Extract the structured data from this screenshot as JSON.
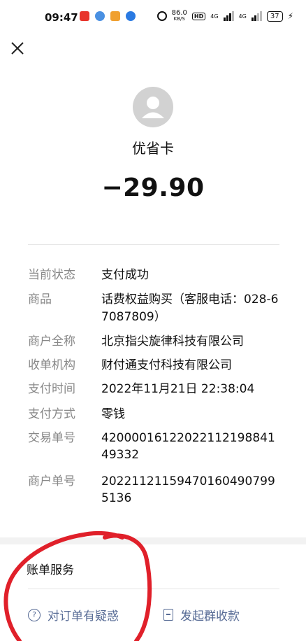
{
  "status_bar": {
    "time": "09:47",
    "net_speed_value": "86.0",
    "net_speed_unit": "KB/S",
    "hd_badge": "HD",
    "signal_1": "4G",
    "signal_2": "4G",
    "battery": "37"
  },
  "merchant": {
    "name": "优省卡",
    "avatar_icon": "user-avatar-icon"
  },
  "amount": "−29.90",
  "details": [
    {
      "label": "当前状态",
      "value": "支付成功"
    },
    {
      "label": "商品",
      "value": "话费权益购买（客服电话：028-67087809）"
    },
    {
      "label": "商户全称",
      "value": "北京指尖旋律科技有限公司"
    },
    {
      "label": "收单机构",
      "value": "财付通支付科技有限公司"
    },
    {
      "label": "支付时间",
      "value": "2022年11月21日 22:38:04"
    },
    {
      "label": "支付方式",
      "value": "零钱"
    },
    {
      "label": "交易单号",
      "value": "4200001612202211219884149332"
    },
    {
      "label": "商户单号",
      "value": "202211211594701604907995136"
    }
  ],
  "bill_service": {
    "title": "账单服务",
    "question_label": "对订单有疑惑",
    "group_collect_label": "发起群收款"
  },
  "colors": {
    "link": "#576b95",
    "annotation": "#e0202a"
  }
}
